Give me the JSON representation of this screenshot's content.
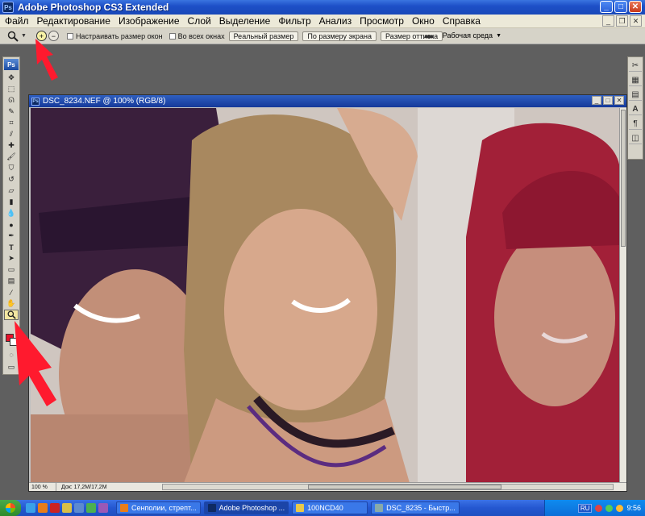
{
  "app": {
    "title": "Adobe Photoshop CS3 Extended",
    "ps_badge": "Ps"
  },
  "menu": [
    "Файл",
    "Редактирование",
    "Изображение",
    "Слой",
    "Выделение",
    "Фильтр",
    "Анализ",
    "Просмотр",
    "Окно",
    "Справка"
  ],
  "options": {
    "checkbox_resize": "Настраивать размер окон",
    "checkbox_all_windows": "Во всех окнах",
    "btn_actual": "Реальный размер",
    "btn_fit": "По размеру экрана",
    "btn_print": "Размер оттиска",
    "workspace_label": "Рабочая среда"
  },
  "toolbox": {
    "logo": "Ps"
  },
  "document": {
    "title": "DSC_8234.NEF @ 100% (RGB/8)",
    "zoom": "100 %",
    "doc_size": "Док: 17,2M/17,2M"
  },
  "taskbar": {
    "tasks": [
      "Сенполии, стрепт...",
      "Adobe Photoshop ...",
      "100NCD40",
      "DSC_8235 - Быстр..."
    ],
    "lang": "RU",
    "clock": "9:56"
  },
  "colors": {
    "foreground": "#e8122a",
    "background": "#ffffff",
    "arrow": "#ff1a2e"
  }
}
